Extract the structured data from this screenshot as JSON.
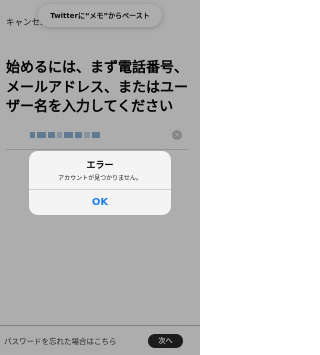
{
  "header": {
    "cancel_label": "キャンセル"
  },
  "paste_banner": {
    "text": "Twitterに“メモ”からペースト"
  },
  "main": {
    "heading": "始めるには、まず電話番号、メールアドレス、またはユーザー名を入力してください",
    "identifier_field": {
      "value": "",
      "clear_icon": "×"
    }
  },
  "alert": {
    "title": "エラー",
    "message": "アカウントが見つかりません。",
    "ok_label": "OK"
  },
  "footer": {
    "forgot_password_label": "パスワードを忘れた場合はこちら",
    "next_label": "次へ"
  },
  "colors": {
    "accent": "#1d7ff0",
    "next_button": "#2a2a2a",
    "overlay": "rgba(0,0,0,0.32)"
  }
}
